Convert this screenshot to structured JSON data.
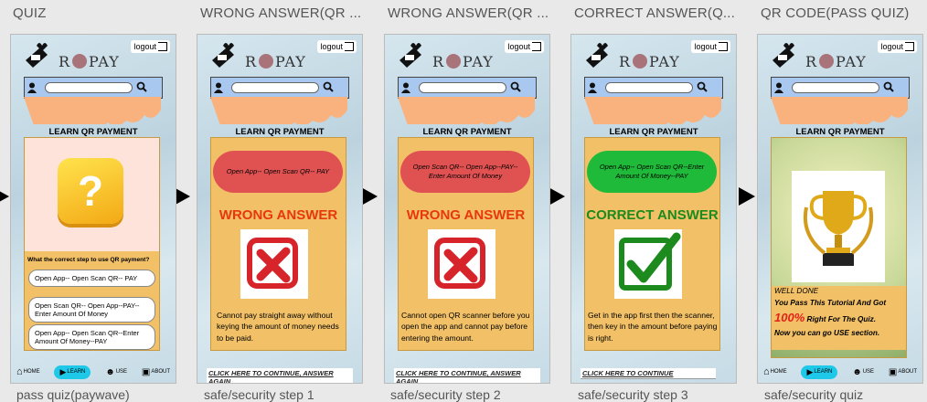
{
  "frames": [
    {
      "title": "QUIZ",
      "caption": "pass quiz(paywave)"
    },
    {
      "title": "WRONG ANSWER(QR ...",
      "caption": "safe/security step 1"
    },
    {
      "title": "WRONG ANSWER(QR ...",
      "caption": "safe/security step 2"
    },
    {
      "title": "CORRECT ANSWER(Q...",
      "caption": "safe/security step 3"
    },
    {
      "title": "QR CODE(PASS QUIZ)",
      "caption": "safe/security quiz"
    }
  ],
  "common": {
    "logout_label": "logout",
    "logo_text_left": "R",
    "logo_text_right": "PAY",
    "section_title": "LEARN QR PAYMENT"
  },
  "nav": {
    "home": "HOME",
    "learn": "LEARN",
    "use": "USE",
    "about": "ABOUT"
  },
  "quiz": {
    "question": "What the correct step to use QR payment?",
    "options": [
      "Open App-- Open Scan QR-- PAY",
      "Open Scan QR-- Open App--PAY--Enter Amount Of Money",
      "Open App-- Open Scan QR--Enter Amount Of Money--PAY"
    ]
  },
  "step1": {
    "pill": "Open App-- Open Scan QR-- PAY",
    "result": "WRONG ANSWER",
    "desc": "Cannot pay straight away without keying the amount of money needs to be paid.",
    "continue": "CLICK HERE TO CONTINUE, ANSWER AGAIN"
  },
  "step2": {
    "pill": "Open Scan QR-- Open App--PAY--Enter Amount Of Money",
    "result": "WRONG ANSWER",
    "desc": "Cannot open QR scanner before you open the app and cannot pay before entering the amount.",
    "continue": "CLICK HERE TO CONTINUE, ANSWER AGAIN"
  },
  "step3": {
    "pill": "Open App-- Open Scan QR--Enter Amount Of Money--PAY",
    "result": "CORRECT ANSWER",
    "desc": "Get in the app first then the scanner, then key in the amount before paying is right.",
    "continue": "CLICK HERE TO CONTINUE"
  },
  "pass": {
    "well_done": "WELL DONE",
    "line1": "You Pass This Tutorial And Got",
    "percent": "100%",
    "line2": "Right For The Quiz.",
    "line3": "Now you can go USE section."
  },
  "colors": {
    "wrong_pill": "#e05252",
    "correct_pill": "#1fba3a",
    "wrong_text": "#e8370e",
    "correct_text": "#1c8a1c",
    "card": "#f2c167",
    "learn_pill": "#1ec8e8"
  }
}
